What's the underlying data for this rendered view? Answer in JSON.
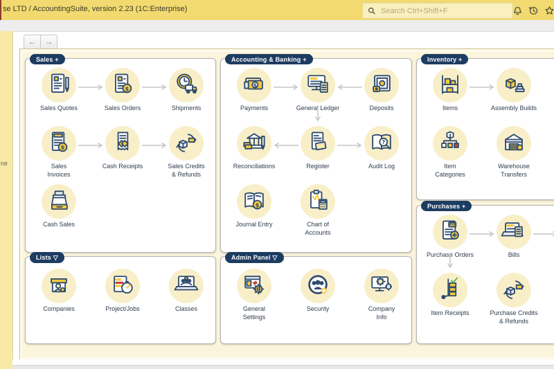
{
  "titlebar": {
    "title": "se LTD / AccountingSuite, version 2.23  (1C:Enterprise)",
    "search_placeholder": "Search Ctrl+Shift+F",
    "icons": [
      "search-icon",
      "bell-icon",
      "history-icon",
      "favorites-star-icon"
    ]
  },
  "nav": {
    "back": "←",
    "forward": "→"
  },
  "sidebar": {
    "fragment": "ne"
  },
  "colors": {
    "titlebar": "#f2da71",
    "title_edge_red": "#8e3b2d",
    "badge": "#1d3c61",
    "panel_border": "#b3b3b3",
    "icon_circle": "#f8efc9",
    "icon_navy": "#2e4b6e",
    "icon_yellow": "#f3c83f",
    "frame_bg": "#fbf5de",
    "frame_border": "#cfc190",
    "arrow": "#c5c5c5"
  },
  "panels": [
    {
      "id": "sales",
      "badge": "Sales +",
      "items": [
        {
          "id": "sales-quotes",
          "label": "Sales Quotes",
          "icon": "sales-quotes",
          "col": 0,
          "row": 0
        },
        {
          "id": "sales-orders",
          "label": "Sales Orders",
          "icon": "sales-orders",
          "col": 1,
          "row": 0
        },
        {
          "id": "shipments",
          "label": "Shipments",
          "icon": "shipments",
          "col": 2,
          "row": 0
        },
        {
          "id": "sales-invoices",
          "label": "Sales\nInvoices",
          "icon": "sales-invoices",
          "col": 0,
          "row": 1
        },
        {
          "id": "cash-receipts",
          "label": "Cash Receipts",
          "icon": "cash-receipts",
          "col": 1,
          "row": 1
        },
        {
          "id": "sales-credits-refunds",
          "label": "Sales Credits\n& Refunds",
          "icon": "cycle-box",
          "col": 2,
          "row": 1
        },
        {
          "id": "cash-sales",
          "label": "Cash Sales",
          "icon": "cash-register",
          "col": 0,
          "row": 2
        }
      ],
      "arrows": [
        {
          "type": "h",
          "col": 0,
          "row": 0,
          "dir": "right"
        },
        {
          "type": "h",
          "col": 1,
          "row": 0,
          "dir": "right"
        },
        {
          "type": "h",
          "col": 0,
          "row": 1,
          "dir": "right"
        },
        {
          "type": "h",
          "col": 1,
          "row": 1,
          "dir": "right"
        }
      ]
    },
    {
      "id": "accounting",
      "badge": "Accounting & Banking +",
      "items": [
        {
          "id": "payments",
          "label": "Payments",
          "icon": "payments",
          "col": 0,
          "row": 0
        },
        {
          "id": "general-ledger",
          "label": "General Ledger",
          "icon": "general-ledger",
          "col": 1,
          "row": 0
        },
        {
          "id": "deposits",
          "label": "Deposits",
          "icon": "deposits",
          "col": 2,
          "row": 0
        },
        {
          "id": "reconciliations",
          "label": "Reconciliations",
          "icon": "reconciliations",
          "col": 0,
          "row": 1
        },
        {
          "id": "register",
          "label": "Register",
          "icon": "register",
          "col": 1,
          "row": 1
        },
        {
          "id": "audit-log",
          "label": "Audit Log",
          "icon": "audit-log",
          "col": 2,
          "row": 1
        },
        {
          "id": "journal-entry",
          "label": "Journal Entry",
          "icon": "journal-entry",
          "col": 0,
          "row": 2
        },
        {
          "id": "chart-of-accounts",
          "label": "Chart of\nAccounts",
          "icon": "chart-of-accounts",
          "col": 1,
          "row": 2
        }
      ],
      "arrows": [
        {
          "type": "h",
          "col": 0,
          "row": 0,
          "dir": "right"
        },
        {
          "type": "h",
          "col": 1,
          "row": 0,
          "dir": "left"
        },
        {
          "type": "v",
          "col": 1,
          "row": 0,
          "dir": "down"
        },
        {
          "type": "h",
          "col": 0,
          "row": 1,
          "dir": "left"
        },
        {
          "type": "h",
          "col": 1,
          "row": 1,
          "dir": "right"
        }
      ]
    },
    {
      "id": "inventory",
      "badge": "Inventory +",
      "items": [
        {
          "id": "items",
          "label": "Items",
          "icon": "items",
          "col": 0,
          "row": 0
        },
        {
          "id": "assembly-builds",
          "label": "Assembly Builds",
          "icon": "assembly-builds",
          "col": 1,
          "row": 0
        },
        {
          "id": "item-categories",
          "label": "Item\nCategories",
          "icon": "item-categories",
          "col": 0,
          "row": 1
        },
        {
          "id": "warehouse-transfers",
          "label": "Warehouse\nTransfers",
          "icon": "warehouse-transfers",
          "col": 1,
          "row": 1
        }
      ],
      "arrows": [
        {
          "type": "h",
          "col": 0,
          "row": 0,
          "dir": "right"
        }
      ]
    },
    {
      "id": "purchases",
      "badge": "Purchases +",
      "items": [
        {
          "id": "purchase-orders",
          "label": "Purchase Orders",
          "icon": "purchase-orders",
          "col": 0,
          "row": 0
        },
        {
          "id": "bills",
          "label": "Bills",
          "icon": "bills",
          "col": 1,
          "row": 0
        },
        {
          "id": "item-receipts",
          "label": "Item Receipts",
          "icon": "item-receipts",
          "col": 0,
          "row": 1
        },
        {
          "id": "purchase-credits-refunds",
          "label": "Purchase Credits\n& Refunds",
          "icon": "cycle-box",
          "col": 1,
          "row": 1
        }
      ],
      "arrows": [
        {
          "type": "h",
          "col": 0,
          "row": 0,
          "dir": "right"
        },
        {
          "type": "h",
          "col": 1,
          "row": 0,
          "dir": "right"
        },
        {
          "type": "v",
          "col": 0,
          "row": 0,
          "dir": "down"
        }
      ]
    },
    {
      "id": "lists",
      "badge": "Lists ▽",
      "items": [
        {
          "id": "companies",
          "label": "Companies",
          "icon": "companies",
          "col": 0,
          "row": 0
        },
        {
          "id": "project-jobs",
          "label": "Project/Jobs",
          "icon": "project-jobs",
          "col": 1,
          "row": 0
        },
        {
          "id": "classes",
          "label": "Classes",
          "icon": "classes",
          "col": 2,
          "row": 0
        }
      ],
      "arrows": []
    },
    {
      "id": "admin",
      "badge": "Admin Panel ▽",
      "items": [
        {
          "id": "general-settings",
          "label": "General\nSettings",
          "icon": "general-settings",
          "col": 0,
          "row": 0
        },
        {
          "id": "security",
          "label": "Security",
          "icon": "security",
          "col": 1,
          "row": 0
        },
        {
          "id": "company-info",
          "label": "Company\nInfo",
          "icon": "company-info",
          "col": 2,
          "row": 0
        }
      ],
      "arrows": []
    }
  ]
}
